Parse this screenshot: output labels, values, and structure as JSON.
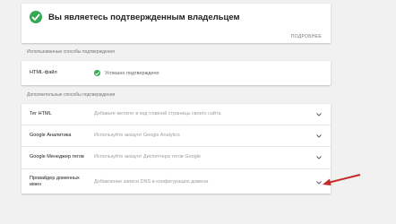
{
  "owner": {
    "title": "Вы являетесь подтвержденным владельцем",
    "more_label": "ПОДРОБНЕЕ"
  },
  "used_methods": {
    "section_label": "Использованные способы подтверждения",
    "items": [
      {
        "name": "HTML-файл",
        "status": "Успешно подтверждено"
      }
    ]
  },
  "extra_methods": {
    "section_label": "Дополнительные способы подтверждения",
    "items": [
      {
        "name": "Тег HTML",
        "description": "Добавьте метатег в код главной страницы своего сайта"
      },
      {
        "name": "Google Аналитика",
        "description": "Используйте аккаунт Google Analytics"
      },
      {
        "name": "Google Менеджер тегов",
        "description": "Используйте аккаунт Диспетчера тегов Google"
      },
      {
        "name": "Провайдер доменных имен",
        "description": "Добавление записи DNS в конфигурацию домена"
      }
    ]
  },
  "colors": {
    "success": "#34a853",
    "annotation_arrow": "#c62828",
    "background": "#f1f1f1"
  },
  "icons": {
    "verified": "check-circle-icon",
    "expand": "chevron-down-icon",
    "annotation": "red-arrow"
  }
}
